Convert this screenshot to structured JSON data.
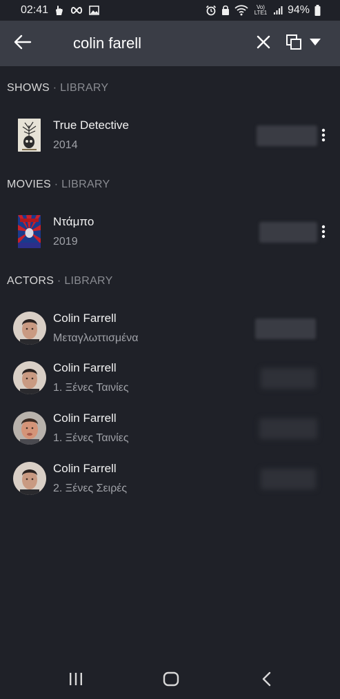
{
  "status_bar": {
    "time": "02:41",
    "battery": "94%",
    "network_label": "Vo) LTE1"
  },
  "toolbar": {
    "query": "colin farell",
    "back_icon": "arrow-left-icon",
    "clear_icon": "close-icon",
    "scope_icon": "copy-stack-icon",
    "dropdown_icon": "caret-down-icon"
  },
  "sections": {
    "shows": {
      "title": "SHOWS",
      "separator": " · ",
      "subtitle": "LIBRARY",
      "items": [
        {
          "title": "True Detective",
          "subtitle": "2014"
        }
      ]
    },
    "movies": {
      "title": "MOVIES",
      "separator": " · ",
      "subtitle": "LIBRARY",
      "items": [
        {
          "title": "Ντάμπο",
          "subtitle": "2019"
        }
      ]
    },
    "actors": {
      "title": "ACTORS",
      "separator": " · ",
      "subtitle": "LIBRARY",
      "items": [
        {
          "title": "Colin Farrell",
          "subtitle": "Μεταγλωττισμένα"
        },
        {
          "title": "Colin Farrell",
          "subtitle": "1. Ξένες Ταινίες"
        },
        {
          "title": "Colin Farrell",
          "subtitle": "1. Ξένες Ταινίες"
        },
        {
          "title": "Colin Farrell",
          "subtitle": "2. Ξένες Σειρές"
        }
      ]
    }
  },
  "colors": {
    "background": "#1f2128",
    "toolbar": "#3a3d46",
    "primary_text": "#f2f2f2",
    "secondary_text": "#a0a2a8"
  }
}
